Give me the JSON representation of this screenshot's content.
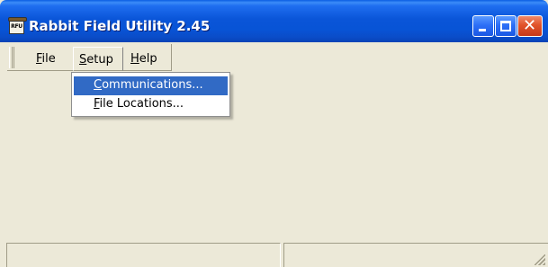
{
  "window": {
    "title": "Rabbit Field Utility 2.45",
    "icon_text": "RFU",
    "icon": "rabbit-field-utility-app-icon",
    "controls": {
      "minimize_icon": "minimize-icon",
      "maximize_icon": "maximize-icon",
      "close_icon": "close-icon",
      "close_glyph": "✕"
    },
    "colors": {
      "titlebar": "#0a55d8",
      "face": "#ece9d8",
      "highlight": "#316ac5",
      "close_button": "#e1532a"
    }
  },
  "menubar": {
    "file": {
      "pre": "",
      "mnemonic": "F",
      "post": "ile"
    },
    "setup": {
      "pre": "",
      "mnemonic": "S",
      "post": "etup",
      "state": "open"
    },
    "help": {
      "pre": "",
      "mnemonic": "H",
      "post": "elp"
    }
  },
  "dropdown": {
    "items": [
      {
        "pre": "",
        "mnemonic": "C",
        "post": "ommunications...",
        "highlighted": true
      },
      {
        "pre": "",
        "mnemonic": "F",
        "post": "ile Locations...",
        "highlighted": false
      }
    ]
  },
  "statusbar": {
    "left_text": "",
    "right_text": ""
  }
}
